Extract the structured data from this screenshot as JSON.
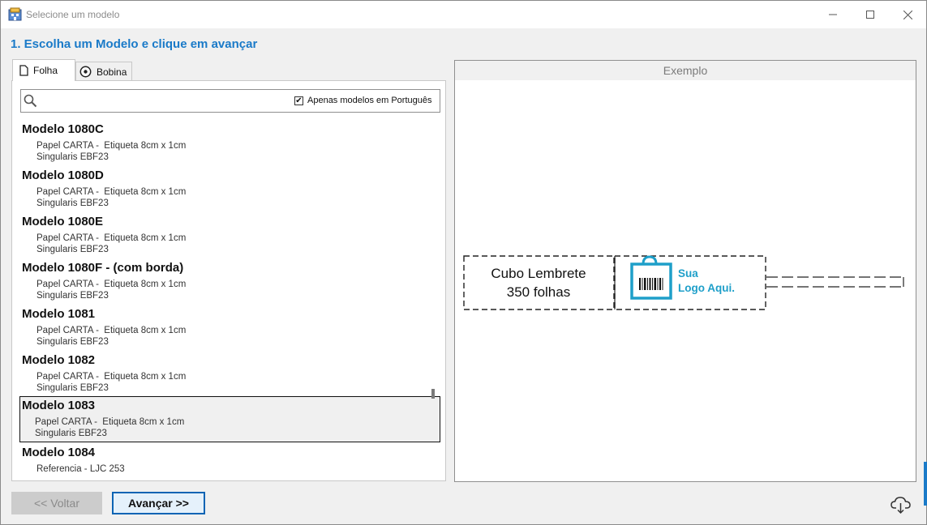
{
  "window": {
    "title": "Selecione um modelo"
  },
  "heading": "1. Escolha um Modelo e clique em avançar",
  "tabs": [
    {
      "label": "Folha",
      "active": true
    },
    {
      "label": "Bobina",
      "active": false
    }
  ],
  "search": {
    "value": "",
    "placeholder": "",
    "checkbox_label": "Apenas modelos em Português",
    "checkbox_checked": true
  },
  "models": [
    {
      "name": "Modelo 1080C",
      "line1": "Papel CARTA -  Etiqueta 8cm x 1cm",
      "line2": "Singularis EBF23",
      "selected": false
    },
    {
      "name": "Modelo 1080D",
      "line1": "Papel CARTA -  Etiqueta 8cm x 1cm",
      "line2": "Singularis EBF23",
      "selected": false
    },
    {
      "name": "Modelo 1080E",
      "line1": "Papel CARTA -  Etiqueta 8cm x 1cm",
      "line2": "Singularis EBF23",
      "selected": false
    },
    {
      "name": "Modelo 1080F - (com borda)",
      "line1": "Papel CARTA -  Etiqueta 8cm x 1cm",
      "line2": "Singularis EBF23",
      "selected": false
    },
    {
      "name": "Modelo 1081",
      "line1": "Papel CARTA -  Etiqueta 8cm x 1cm",
      "line2": "Singularis EBF23",
      "selected": false
    },
    {
      "name": "Modelo 1082",
      "line1": "Papel CARTA -  Etiqueta 8cm x 1cm",
      "line2": "Singularis EBF23",
      "selected": false
    },
    {
      "name": "Modelo 1083",
      "line1": "Papel CARTA -  Etiqueta 8cm x 1cm",
      "line2": "Singularis EBF23",
      "selected": true
    },
    {
      "name": "Modelo 1084",
      "line1": "Referencia - LJC 253",
      "line2": "",
      "selected": false
    }
  ],
  "preview": {
    "header": "Exemplo",
    "label_line1": "Cubo Lembrete",
    "label_line2": "350 folhas",
    "logo_line1": "Sua",
    "logo_line2": "Logo Aqui."
  },
  "buttons": {
    "back": "<< Voltar",
    "next": "Avançar >>"
  },
  "colors": {
    "accent": "#1a7ac8",
    "logo": "#1e9fc9",
    "primary_border": "#0a64b4"
  }
}
